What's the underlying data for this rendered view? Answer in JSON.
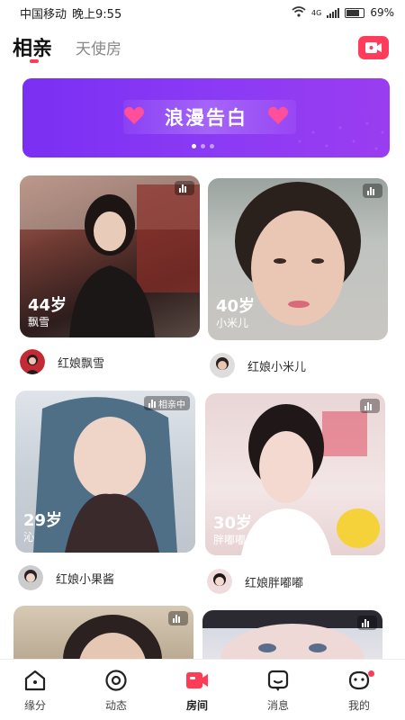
{
  "status_bar": {
    "carrier": "中国移动",
    "time": "晚上9:55",
    "network": "4G",
    "battery": "69%"
  },
  "top_tabs": {
    "active": "相亲",
    "other": "天使房"
  },
  "banner": {
    "text": "浪漫告白"
  },
  "cards": [
    {
      "age": "44岁",
      "nickname": "飘雪",
      "live_label": "",
      "host": "红娘飘雪"
    },
    {
      "age": "40岁",
      "nickname": "小米儿",
      "live_label": "",
      "host": "红娘小米儿"
    },
    {
      "age": "29岁",
      "nickname": "沁",
      "live_label": "相亲中",
      "host": "红娘小果酱"
    },
    {
      "age": "30岁",
      "nickname": "胖嘟嘟",
      "live_label": "",
      "host": "红娘胖嘟嘟"
    },
    {
      "age": "",
      "nickname": "",
      "live_label": "",
      "host": ""
    },
    {
      "age": "",
      "nickname": "",
      "live_label": "",
      "host": ""
    }
  ],
  "bottom_nav": [
    {
      "label": "缘分",
      "icon": "house-icon"
    },
    {
      "label": "动态",
      "icon": "circle-target-icon"
    },
    {
      "label": "房间",
      "icon": "video-camera-icon",
      "active": true
    },
    {
      "label": "消息",
      "icon": "message-icon"
    },
    {
      "label": "我的",
      "icon": "profile-face-icon",
      "badge": true
    }
  ],
  "colors": {
    "accent": "#ff3b56",
    "banner": "#8a3af5"
  }
}
